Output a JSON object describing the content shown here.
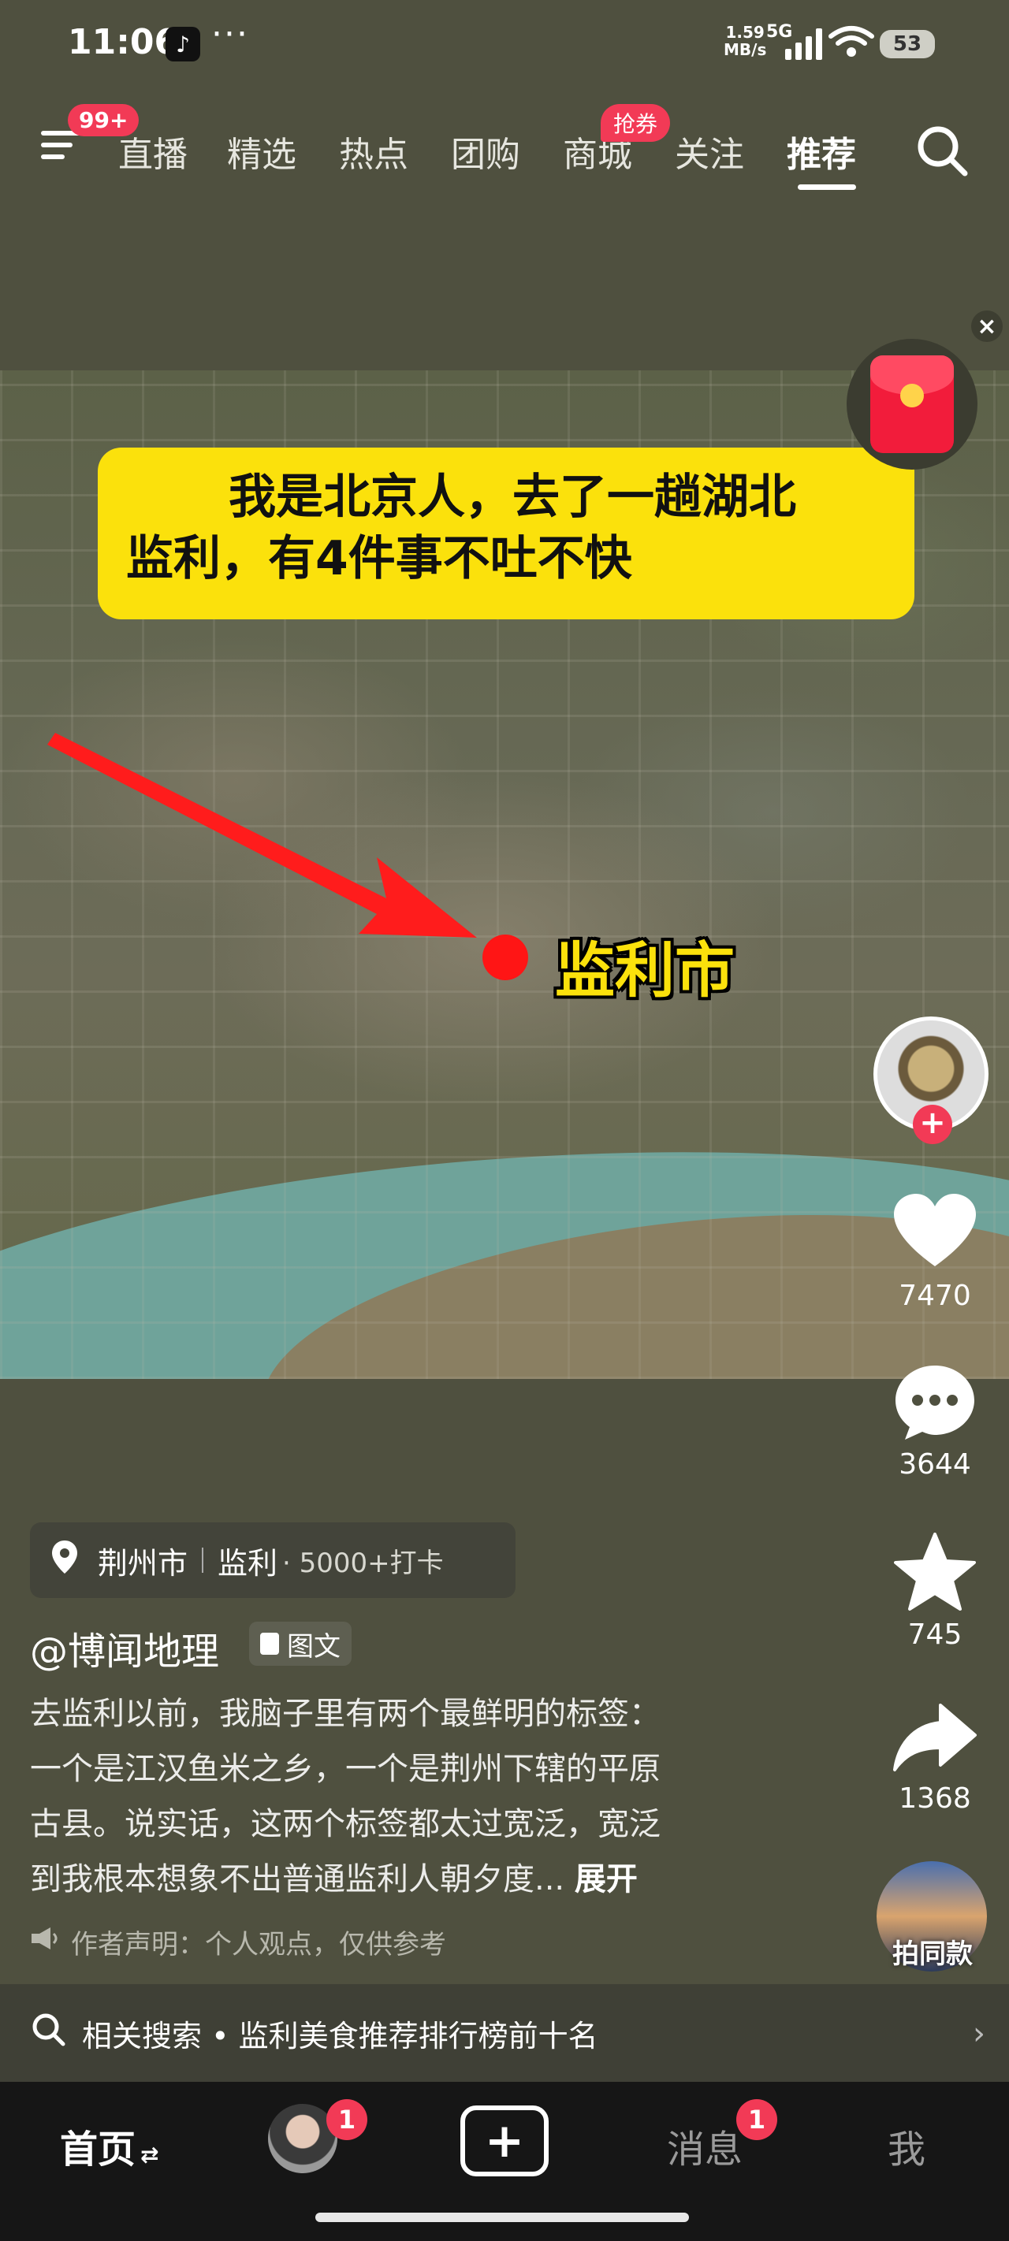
{
  "status_bar": {
    "time": "11:06",
    "dots": "···",
    "net_speed_value": "1.59",
    "net_speed_unit": "MB/s",
    "net_type": "5G",
    "battery": "53"
  },
  "top_nav": {
    "menu_badge": "99+",
    "tabs": [
      {
        "label": "直播"
      },
      {
        "label": "精选"
      },
      {
        "label": "热点"
      },
      {
        "label": "团购"
      },
      {
        "label": "商城"
      },
      {
        "label": "关注"
      },
      {
        "label": "推荐"
      }
    ],
    "active_tab": "推荐",
    "mall_badge": "抢券"
  },
  "video": {
    "headline_line1": "我是北京人，去了一趟湖北",
    "headline_line2": "监利，有4件事不吐不快",
    "map_label": "监利市"
  },
  "actions": {
    "likes": "7470",
    "comments": "3644",
    "favorites": "745",
    "shares": "1368",
    "same_style": "拍同款"
  },
  "post": {
    "location_city": "荆州市",
    "location_place": "监利",
    "location_checkins": "· 5000+打卡",
    "author": "@博闻地理",
    "type_tag": "图文",
    "description_lines": [
      "去监利以前，我脑子里有两个最鲜明的标签：",
      "一个是江汉鱼米之乡，一个是荆州下辖的平原",
      "古县。说实话，这两个标签都太过宽泛，宽泛",
      "到我根本想象不出普通监利人朝夕度..."
    ],
    "expand": "展开",
    "disclaimer": "作者声明：个人观点，仅供参考"
  },
  "related_search": {
    "text": "相关搜索 • 监利美食推荐排行榜前十名"
  },
  "bottom_nav": {
    "home": "首页",
    "home_switch": "⇄",
    "friends_badge": "1",
    "create": "+",
    "messages": "消息",
    "messages_badge": "1",
    "me": "我"
  },
  "colors": {
    "accent": "#f23a56",
    "headline_bg": "#fbe10c",
    "background": "#4f503f"
  }
}
